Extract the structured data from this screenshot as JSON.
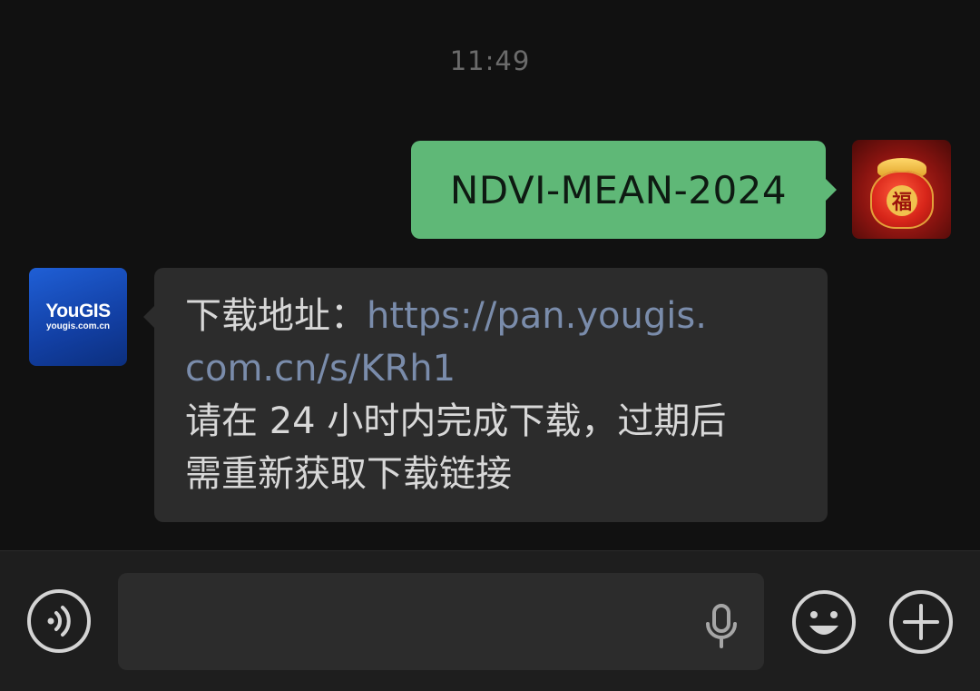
{
  "chat": {
    "timestamp": "11:49",
    "messages": [
      {
        "direction": "outgoing",
        "text": "NDVI-MEAN-2024",
        "bubble_color": "#5fb877"
      },
      {
        "direction": "incoming",
        "sender_avatar": {
          "brand": "YouGIS",
          "site": "yougis.com.cn"
        },
        "label": "下载地址：",
        "link_line1": "https://pan.yougis.",
        "link_line2": "com.cn/s/KRh1",
        "note_line1": "请在 24 小时内完成下载，过期后",
        "note_line2": "需重新获取下载链接",
        "link_color": "#7a8cab",
        "bubble_color": "#2c2c2c"
      }
    ],
    "self_avatar": {
      "glyph": "福"
    }
  },
  "input_bar": {
    "icons": [
      "voice-icon",
      "microphone-icon",
      "emoji-icon",
      "plus-icon"
    ],
    "placeholder": ""
  }
}
